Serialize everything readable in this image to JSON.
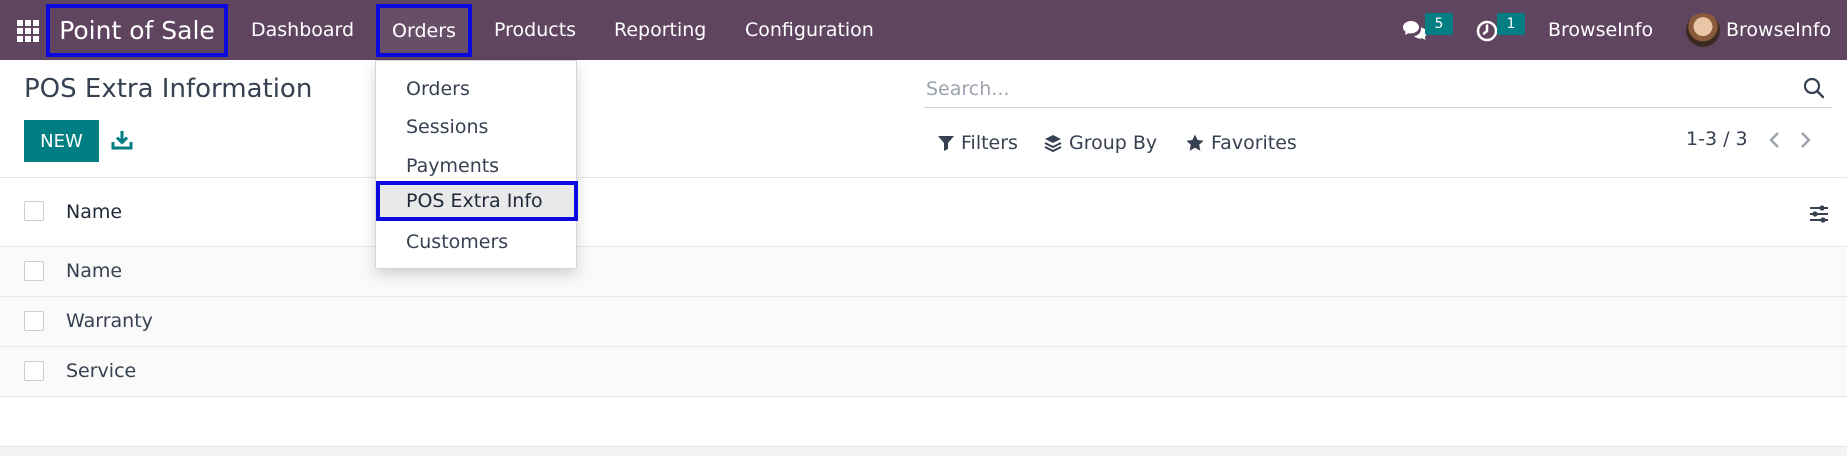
{
  "navbar": {
    "app_title": "Point of Sale",
    "menu": [
      "Dashboard",
      "Orders",
      "Products",
      "Reporting",
      "Configuration"
    ],
    "messages_count": "5",
    "activities_count": "1",
    "company": "BrowseInfo",
    "user": "BrowseInfo",
    "color": "#5f4560"
  },
  "orders_dropdown": {
    "items": [
      "Orders",
      "Sessions",
      "Payments",
      "POS Extra Info",
      "Customers"
    ],
    "active_index": 3
  },
  "control_panel": {
    "title": "POS Extra Information",
    "new_label": "NEW",
    "search_placeholder": "Search...",
    "filters_label": "Filters",
    "group_by_label": "Group By",
    "favorites_label": "Favorites",
    "pager": "1-3 / 3"
  },
  "list": {
    "column_header": "Name",
    "rows": [
      "Name",
      "Warranty",
      "Service"
    ]
  },
  "colors": {
    "accent": "#017e84",
    "highlight_border": "#0a0ae0"
  }
}
